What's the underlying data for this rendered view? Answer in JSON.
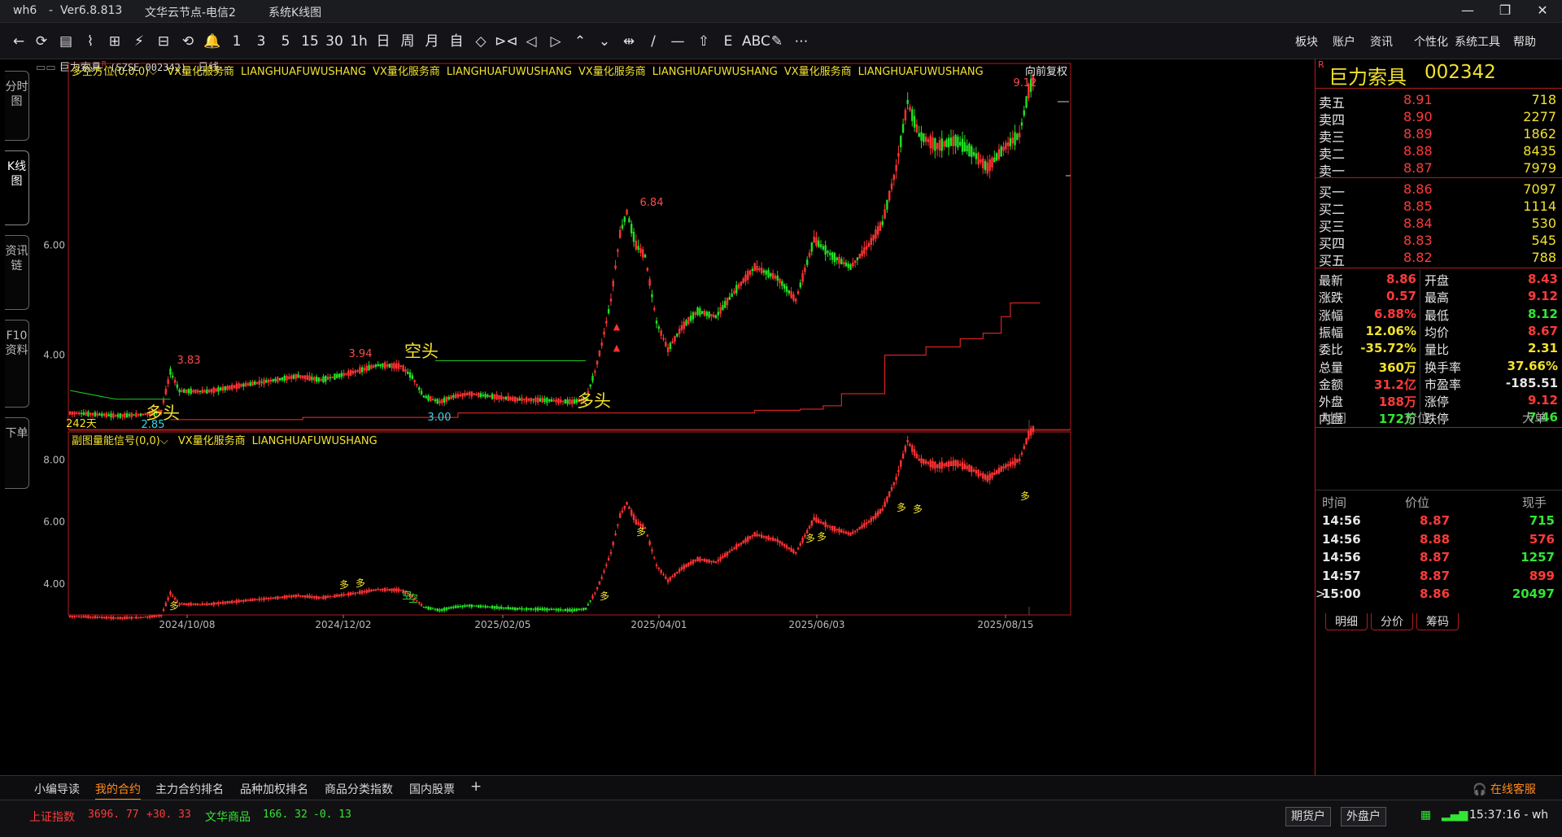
{
  "titlebar": {
    "app": "wh6",
    "separator": "-",
    "version": "Ver6.8.813",
    "server": "文华云节点-电信2",
    "view": "系统K线图",
    "minimize": "—",
    "restore": "❐",
    "close": "✕"
  },
  "toolbar": {
    "buttons": [
      "←",
      "⟳",
      "▤",
      "⌇",
      "⊞",
      "⚡",
      "⊟",
      "⟲",
      "🔔",
      "1",
      "3",
      "5",
      "15",
      "30",
      "1h",
      "日",
      "周",
      "月",
      "自",
      "◇",
      "⊳⊲",
      "◁",
      "▷",
      "⌃",
      "⌄",
      "⇹",
      "/",
      "—",
      "⇧",
      "E",
      "ABC",
      "✎",
      "⋯"
    ],
    "menus": [
      "板块",
      "账户",
      "资讯",
      "个性化",
      "系统工具",
      "帮助"
    ]
  },
  "left_tabs": [
    "分时图",
    "K线图",
    "资讯链",
    "F10资料",
    "下单"
  ],
  "chart": {
    "symbol": "巨力索具",
    "r_mark": "R",
    "code": "(SZSE 002342)",
    "period": "日线",
    "period_arrow": "⌵",
    "main_indicator": "多空方位(0,0,0)",
    "main_ads": [
      "VX量化服务商",
      "LIANGHUAFUWUSHANG",
      "VX量化服务商",
      "LIANGHUAFUWUSHANG",
      "VX量化服务商",
      "LIANGHUAFUWUSHANG",
      "VX量化服务商",
      "LIANGHUAFUWUSHANG"
    ],
    "adjust": "向前复权",
    "sub_indicator": "副图量能信号(0,0)",
    "sub_ads": [
      "VX量化服务商",
      "LIANGHUAFUWUSHANG"
    ],
    "main_yaxis": [
      "6.00",
      "4.00"
    ],
    "sub_yaxis": [
      "8.00",
      "6.00",
      "4.00"
    ],
    "xaxis": [
      "2024/10/08",
      "2024/12/02",
      "2025/02/05",
      "2025/04/01",
      "2025/06/03",
      "2025/08/15"
    ],
    "days_label": "242天",
    "annotations": {
      "high_1": "3.83",
      "high_2": "3.94",
      "high_3": "6.84",
      "high_4": "9.12",
      "low_1": "2.85",
      "low_2": "3.00",
      "long_1": "多头",
      "long_2": "多头",
      "short_1": "空头",
      "sig_long": "多",
      "sig_short": "空"
    },
    "colors": {
      "up": "#ff3232",
      "down": "#22e022",
      "support": "#ff2a2a",
      "resist": "#1fd01f",
      "border": "#b21c1c"
    }
  },
  "chart_data": {
    "type": "candlestick",
    "title": "巨力索具 (SZSE 002342) 日线",
    "x_ticks": [
      "2024/10/08",
      "2024/12/02",
      "2025/02/05",
      "2025/04/01",
      "2025/06/03",
      "2025/08/15"
    ],
    "y_ticks_main": [
      4.0,
      6.0
    ],
    "y_ticks_sub": [
      4.0,
      6.0,
      8.0
    ],
    "ylim_main": [
      2.65,
      9.3
    ],
    "ylim_sub": [
      3.0,
      8.9
    ],
    "labeled_extremes": {
      "highs": [
        3.83,
        3.94,
        6.84,
        9.12
      ],
      "lows": [
        2.85,
        3.0
      ]
    },
    "price_path": [
      [
        0,
        2.95
      ],
      [
        10,
        2.93
      ],
      [
        20,
        2.9
      ],
      [
        32,
        2.92
      ],
      [
        40,
        2.98
      ],
      [
        44,
        3.7
      ],
      [
        48,
        3.35
      ],
      [
        60,
        3.34
      ],
      [
        75,
        3.45
      ],
      [
        90,
        3.55
      ],
      [
        100,
        3.62
      ],
      [
        110,
        3.55
      ],
      [
        125,
        3.7
      ],
      [
        135,
        3.82
      ],
      [
        145,
        3.8
      ],
      [
        150,
        3.6
      ],
      [
        155,
        3.25
      ],
      [
        162,
        3.15
      ],
      [
        168,
        3.25
      ],
      [
        175,
        3.3
      ],
      [
        185,
        3.25
      ],
      [
        195,
        3.2
      ],
      [
        210,
        3.18
      ],
      [
        220,
        3.15
      ],
      [
        226,
        3.2
      ],
      [
        230,
        3.7
      ],
      [
        233,
        4.2
      ],
      [
        237,
        5.0
      ],
      [
        241,
        6.2
      ],
      [
        244,
        6.6
      ],
      [
        248,
        6.0
      ],
      [
        252,
        5.8
      ],
      [
        257,
        4.6
      ],
      [
        262,
        4.1
      ],
      [
        268,
        4.5
      ],
      [
        275,
        4.8
      ],
      [
        283,
        4.7
      ],
      [
        292,
        5.2
      ],
      [
        300,
        5.6
      ],
      [
        310,
        5.4
      ],
      [
        318,
        5.0
      ],
      [
        326,
        6.1
      ],
      [
        334,
        5.8
      ],
      [
        342,
        5.6
      ],
      [
        350,
        6.0
      ],
      [
        356,
        6.4
      ],
      [
        362,
        7.4
      ],
      [
        367,
        8.6
      ],
      [
        372,
        8.0
      ],
      [
        380,
        7.8
      ],
      [
        388,
        7.9
      ],
      [
        395,
        7.7
      ],
      [
        402,
        7.4
      ],
      [
        410,
        7.8
      ],
      [
        416,
        8.0
      ],
      [
        420,
        8.8
      ],
      [
        422,
        9.0
      ]
    ]
  },
  "quote": {
    "r_mark": "R",
    "name": "巨力索具",
    "code": "002342",
    "asks": [
      {
        "label": "卖五",
        "price": "8.91",
        "vol": "718"
      },
      {
        "label": "卖四",
        "price": "8.90",
        "vol": "2277"
      },
      {
        "label": "卖三",
        "price": "8.89",
        "vol": "1862"
      },
      {
        "label": "卖二",
        "price": "8.88",
        "vol": "8435"
      },
      {
        "label": "卖一",
        "price": "8.87",
        "vol": "7979"
      }
    ],
    "bids": [
      {
        "label": "买一",
        "price": "8.86",
        "vol": "7097"
      },
      {
        "label": "买二",
        "price": "8.85",
        "vol": "1114"
      },
      {
        "label": "买三",
        "price": "8.84",
        "vol": "530"
      },
      {
        "label": "买四",
        "price": "8.83",
        "vol": "545"
      },
      {
        "label": "买五",
        "price": "8.82",
        "vol": "788"
      }
    ],
    "fields": [
      {
        "l": "最新",
        "v": "8.86",
        "c": "red",
        "l2": "开盘",
        "v2": "8.43",
        "c2": "red"
      },
      {
        "l": "涨跌",
        "v": "0.57",
        "c": "red",
        "l2": "最高",
        "v2": "9.12",
        "c2": "red"
      },
      {
        "l": "涨幅",
        "v": "6.88%",
        "c": "red",
        "l2": "最低",
        "v2": "8.12",
        "c2": "grn"
      },
      {
        "l": "振幅",
        "v": "12.06%",
        "c": "yel",
        "l2": "均价",
        "v2": "8.67",
        "c2": "red"
      },
      {
        "l": "委比",
        "v": "-35.72%",
        "c": "yel",
        "l2": "量比",
        "v2": "2.31",
        "c2": "yel"
      },
      {
        "l": "总量",
        "v": "360万",
        "c": "yel",
        "l2": "换手率",
        "v2": "37.66%",
        "c2": "yel"
      },
      {
        "l": "金额",
        "v": "31.2亿",
        "c": "red",
        "l2": "市盈率",
        "v2": "-185.51",
        "c2": "wht"
      },
      {
        "l": "外盘",
        "v": "188万",
        "c": "red",
        "l2": "涨停",
        "v2": "9.12",
        "c2": "red"
      },
      {
        "l": "内盘",
        "v": "172万",
        "c": "grn",
        "l2": "跌停",
        "v2": "7.46",
        "c2": "grn"
      }
    ],
    "big_header": [
      "时间",
      "价位",
      "大单"
    ],
    "ticks_header": [
      "时间",
      "价位",
      "现手"
    ],
    "ticks": [
      {
        "time": "14:56",
        "price": "8.87",
        "vol": "715",
        "vc": "grn"
      },
      {
        "time": "14:56",
        "price": "8.88",
        "vol": "576",
        "vc": "red"
      },
      {
        "time": "14:56",
        "price": "8.87",
        "vol": "1257",
        "vc": "grn"
      },
      {
        "time": "14:57",
        "price": "8.87",
        "vol": "899",
        "vc": "red"
      },
      {
        "time": "15:00",
        "price": "8.86",
        "vol": "20497",
        "vc": "grn"
      }
    ],
    "tick_marker": ">",
    "panel_tabs": [
      "明细",
      "分价",
      "筹码"
    ]
  },
  "bottom_tabs": [
    "小编导读",
    "我的合约",
    "主力合约排名",
    "品种加权排名",
    "商品分类指数",
    "国内股票",
    "+"
  ],
  "service": "在线客服",
  "status": {
    "idx1_name": "上证指数",
    "idx1_value": "3696. 77",
    "idx1_change": "+30. 33",
    "idx2_name": "文华商品",
    "idx2_value": "166. 32",
    "idx2_change": "-0. 13",
    "btn1": "期货户",
    "btn2": "外盘户",
    "time": "15:37:16 - wh"
  }
}
